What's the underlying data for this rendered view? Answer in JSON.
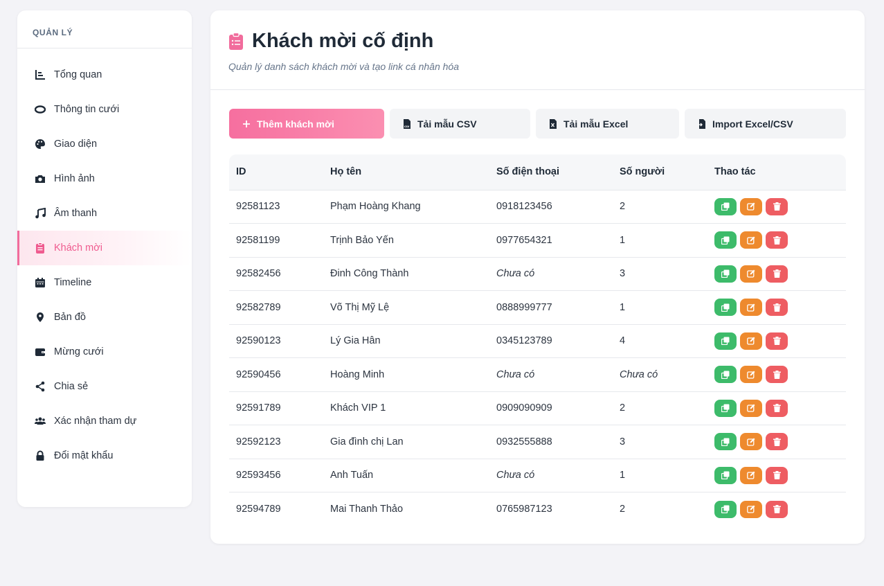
{
  "sidebar": {
    "header": "QUẢN LÝ",
    "items": [
      {
        "label": "Tổng quan",
        "icon": "chart-icon"
      },
      {
        "label": "Thông tin cưới",
        "icon": "ring-icon"
      },
      {
        "label": "Giao diện",
        "icon": "palette-icon"
      },
      {
        "label": "Hình ảnh",
        "icon": "camera-icon"
      },
      {
        "label": "Âm thanh",
        "icon": "music-icon"
      },
      {
        "label": "Khách mời",
        "icon": "clipboard-icon",
        "active": true
      },
      {
        "label": "Timeline",
        "icon": "calendar-icon"
      },
      {
        "label": "Bản đồ",
        "icon": "map-pin-icon"
      },
      {
        "label": "Mừng cưới",
        "icon": "wallet-icon"
      },
      {
        "label": "Chia sẻ",
        "icon": "share-icon"
      },
      {
        "label": "Xác nhận tham dự",
        "icon": "users-icon"
      },
      {
        "label": "Đổi mật khẩu",
        "icon": "lock-icon"
      }
    ]
  },
  "page": {
    "title": "Khách mời cố định",
    "subtitle": "Quản lý danh sách khách mời và tạo link cá nhân hóa"
  },
  "toolbar": {
    "add": "Thêm khách mời",
    "csv_template": "Tải mẫu CSV",
    "excel_template": "Tải mẫu Excel",
    "import": "Import Excel/CSV"
  },
  "table": {
    "headers": {
      "id": "ID",
      "name": "Họ tên",
      "phone": "Số điện thoại",
      "count": "Số người",
      "actions": "Thao tác"
    },
    "rows": [
      {
        "id": "92581123",
        "name": "Phạm Hoàng Khang",
        "phone": "0918123456",
        "count": "2"
      },
      {
        "id": "92581199",
        "name": "Trịnh Bảo Yến",
        "phone": "0977654321",
        "count": "1"
      },
      {
        "id": "92582456",
        "name": "Đinh Công Thành",
        "phone": "Chưa có",
        "count": "3"
      },
      {
        "id": "92582789",
        "name": "Võ Thị Mỹ Lệ",
        "phone": "0888999777",
        "count": "1"
      },
      {
        "id": "92590123",
        "name": "Lý Gia Hân",
        "phone": "0345123789",
        "count": "4"
      },
      {
        "id": "92590456",
        "name": "Hoàng Minh",
        "phone": "Chưa có",
        "count": "Chưa có"
      },
      {
        "id": "92591789",
        "name": "Khách VIP 1",
        "phone": "0909090909",
        "count": "2"
      },
      {
        "id": "92592123",
        "name": "Gia đình chị Lan",
        "phone": "0932555888",
        "count": "3"
      },
      {
        "id": "92593456",
        "name": "Anh Tuấn",
        "phone": "Chưa có",
        "count": "1"
      },
      {
        "id": "92594789",
        "name": "Mai Thanh Thảo",
        "phone": "0765987123",
        "count": "2"
      }
    ]
  },
  "colors": {
    "accent": "#f16c9c",
    "copy": "#3dbb6a",
    "edit": "#ee8a2e",
    "delete": "#ee5d62"
  }
}
